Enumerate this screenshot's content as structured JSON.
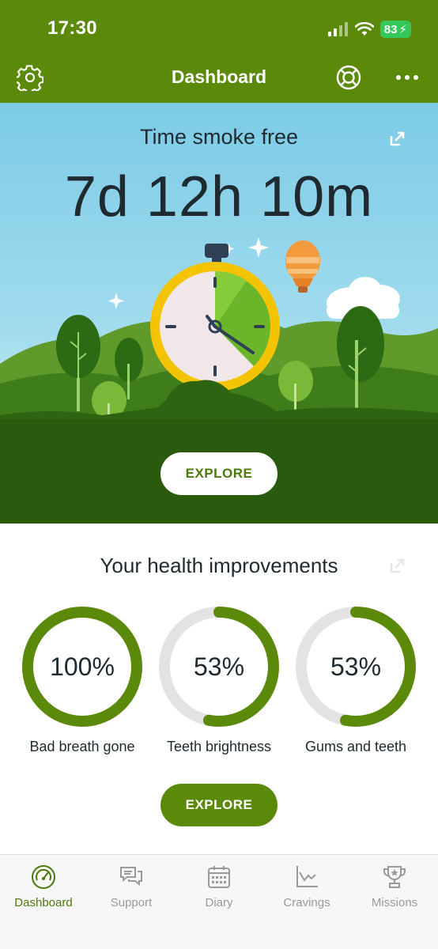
{
  "status_bar": {
    "time": "17:30",
    "battery": "83"
  },
  "header": {
    "title": "Dashboard",
    "icons": [
      "gear-icon",
      "lifebuoy-icon",
      "more-icon"
    ]
  },
  "hero": {
    "title": "Time smoke free",
    "timer": "7d 12h 10m",
    "explore_label": "EXPLORE"
  },
  "health": {
    "title": "Your health improvements",
    "items": [
      {
        "label": "Bad breath gone",
        "percent_text": "100%",
        "progress": 1.0
      },
      {
        "label": "Teeth brightness",
        "percent_text": "53%",
        "progress": 0.53
      },
      {
        "label": "Gums and teeth",
        "percent_text": "53%",
        "progress": 0.53
      }
    ],
    "explore_label": "EXPLORE"
  },
  "colors": {
    "brand": "#5b8a0a",
    "ring_track": "#e3e3e3",
    "tab_inactive": "#9a9a9a"
  },
  "tabs": [
    {
      "label": "Dashboard",
      "icon": "speedometer-icon",
      "active": true
    },
    {
      "label": "Support",
      "icon": "chat-icon",
      "active": false
    },
    {
      "label": "Diary",
      "icon": "calendar-icon",
      "active": false
    },
    {
      "label": "Cravings",
      "icon": "chart-icon",
      "active": false
    },
    {
      "label": "Missions",
      "icon": "trophy-icon",
      "active": false
    }
  ]
}
